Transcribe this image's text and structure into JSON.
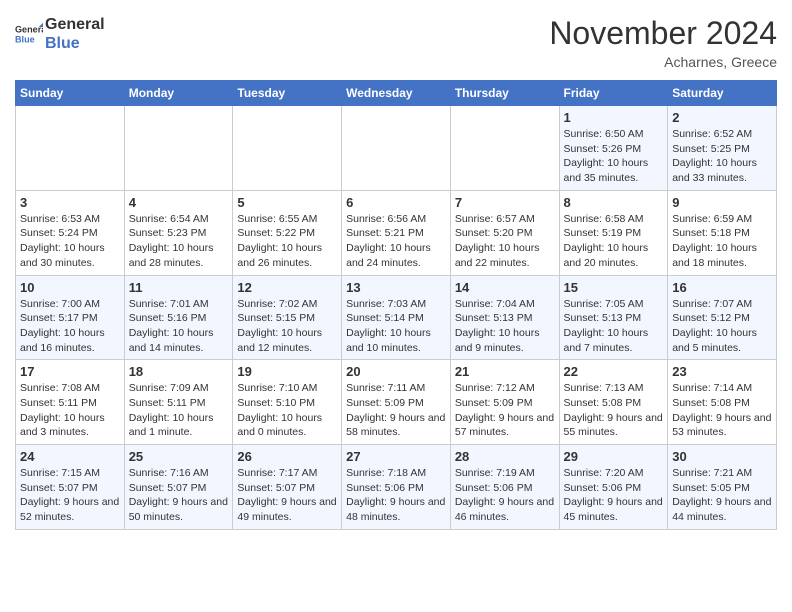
{
  "header": {
    "logo_general": "General",
    "logo_blue": "Blue",
    "month_title": "November 2024",
    "location": "Acharnes, Greece"
  },
  "days_of_week": [
    "Sunday",
    "Monday",
    "Tuesday",
    "Wednesday",
    "Thursday",
    "Friday",
    "Saturday"
  ],
  "weeks": [
    [
      {
        "day": "",
        "info": ""
      },
      {
        "day": "",
        "info": ""
      },
      {
        "day": "",
        "info": ""
      },
      {
        "day": "",
        "info": ""
      },
      {
        "day": "",
        "info": ""
      },
      {
        "day": "1",
        "info": "Sunrise: 6:50 AM\nSunset: 5:26 PM\nDaylight: 10 hours and 35 minutes."
      },
      {
        "day": "2",
        "info": "Sunrise: 6:52 AM\nSunset: 5:25 PM\nDaylight: 10 hours and 33 minutes."
      }
    ],
    [
      {
        "day": "3",
        "info": "Sunrise: 6:53 AM\nSunset: 5:24 PM\nDaylight: 10 hours and 30 minutes."
      },
      {
        "day": "4",
        "info": "Sunrise: 6:54 AM\nSunset: 5:23 PM\nDaylight: 10 hours and 28 minutes."
      },
      {
        "day": "5",
        "info": "Sunrise: 6:55 AM\nSunset: 5:22 PM\nDaylight: 10 hours and 26 minutes."
      },
      {
        "day": "6",
        "info": "Sunrise: 6:56 AM\nSunset: 5:21 PM\nDaylight: 10 hours and 24 minutes."
      },
      {
        "day": "7",
        "info": "Sunrise: 6:57 AM\nSunset: 5:20 PM\nDaylight: 10 hours and 22 minutes."
      },
      {
        "day": "8",
        "info": "Sunrise: 6:58 AM\nSunset: 5:19 PM\nDaylight: 10 hours and 20 minutes."
      },
      {
        "day": "9",
        "info": "Sunrise: 6:59 AM\nSunset: 5:18 PM\nDaylight: 10 hours and 18 minutes."
      }
    ],
    [
      {
        "day": "10",
        "info": "Sunrise: 7:00 AM\nSunset: 5:17 PM\nDaylight: 10 hours and 16 minutes."
      },
      {
        "day": "11",
        "info": "Sunrise: 7:01 AM\nSunset: 5:16 PM\nDaylight: 10 hours and 14 minutes."
      },
      {
        "day": "12",
        "info": "Sunrise: 7:02 AM\nSunset: 5:15 PM\nDaylight: 10 hours and 12 minutes."
      },
      {
        "day": "13",
        "info": "Sunrise: 7:03 AM\nSunset: 5:14 PM\nDaylight: 10 hours and 10 minutes."
      },
      {
        "day": "14",
        "info": "Sunrise: 7:04 AM\nSunset: 5:13 PM\nDaylight: 10 hours and 9 minutes."
      },
      {
        "day": "15",
        "info": "Sunrise: 7:05 AM\nSunset: 5:13 PM\nDaylight: 10 hours and 7 minutes."
      },
      {
        "day": "16",
        "info": "Sunrise: 7:07 AM\nSunset: 5:12 PM\nDaylight: 10 hours and 5 minutes."
      }
    ],
    [
      {
        "day": "17",
        "info": "Sunrise: 7:08 AM\nSunset: 5:11 PM\nDaylight: 10 hours and 3 minutes."
      },
      {
        "day": "18",
        "info": "Sunrise: 7:09 AM\nSunset: 5:11 PM\nDaylight: 10 hours and 1 minute."
      },
      {
        "day": "19",
        "info": "Sunrise: 7:10 AM\nSunset: 5:10 PM\nDaylight: 10 hours and 0 minutes."
      },
      {
        "day": "20",
        "info": "Sunrise: 7:11 AM\nSunset: 5:09 PM\nDaylight: 9 hours and 58 minutes."
      },
      {
        "day": "21",
        "info": "Sunrise: 7:12 AM\nSunset: 5:09 PM\nDaylight: 9 hours and 57 minutes."
      },
      {
        "day": "22",
        "info": "Sunrise: 7:13 AM\nSunset: 5:08 PM\nDaylight: 9 hours and 55 minutes."
      },
      {
        "day": "23",
        "info": "Sunrise: 7:14 AM\nSunset: 5:08 PM\nDaylight: 9 hours and 53 minutes."
      }
    ],
    [
      {
        "day": "24",
        "info": "Sunrise: 7:15 AM\nSunset: 5:07 PM\nDaylight: 9 hours and 52 minutes."
      },
      {
        "day": "25",
        "info": "Sunrise: 7:16 AM\nSunset: 5:07 PM\nDaylight: 9 hours and 50 minutes."
      },
      {
        "day": "26",
        "info": "Sunrise: 7:17 AM\nSunset: 5:07 PM\nDaylight: 9 hours and 49 minutes."
      },
      {
        "day": "27",
        "info": "Sunrise: 7:18 AM\nSunset: 5:06 PM\nDaylight: 9 hours and 48 minutes."
      },
      {
        "day": "28",
        "info": "Sunrise: 7:19 AM\nSunset: 5:06 PM\nDaylight: 9 hours and 46 minutes."
      },
      {
        "day": "29",
        "info": "Sunrise: 7:20 AM\nSunset: 5:06 PM\nDaylight: 9 hours and 45 minutes."
      },
      {
        "day": "30",
        "info": "Sunrise: 7:21 AM\nSunset: 5:05 PM\nDaylight: 9 hours and 44 minutes."
      }
    ]
  ]
}
